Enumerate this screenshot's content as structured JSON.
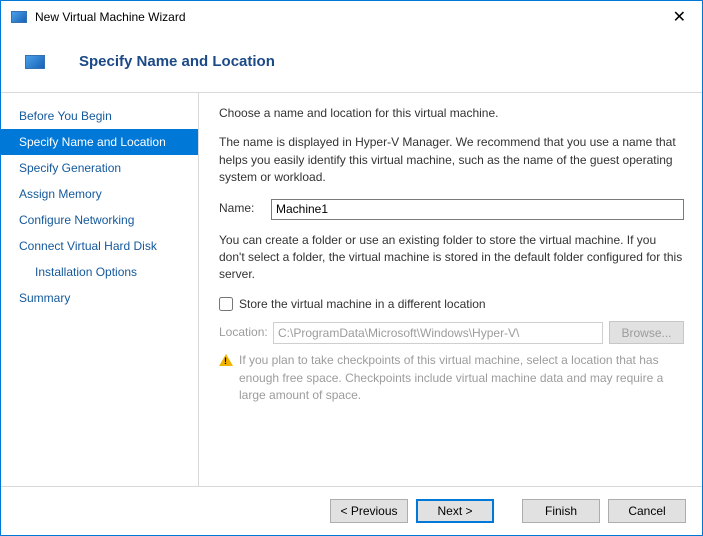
{
  "titlebar": {
    "title": "New Virtual Machine Wizard"
  },
  "header": {
    "title": "Specify Name and Location"
  },
  "sidebar": {
    "items": [
      {
        "label": "Before You Begin"
      },
      {
        "label": "Specify Name and Location"
      },
      {
        "label": "Specify Generation"
      },
      {
        "label": "Assign Memory"
      },
      {
        "label": "Configure Networking"
      },
      {
        "label": "Connect Virtual Hard Disk"
      },
      {
        "label": "Installation Options"
      },
      {
        "label": "Summary"
      }
    ]
  },
  "content": {
    "intro": "Choose a name and location for this virtual machine.",
    "name_help": "The name is displayed in Hyper-V Manager. We recommend that you use a name that helps you easily identify this virtual machine, such as the name of the guest operating system or workload.",
    "name_label": "Name:",
    "name_value": "Machine1",
    "folder_help": "You can create a folder or use an existing folder to store the virtual machine. If you don't select a folder, the virtual machine is stored in the default folder configured for this server.",
    "store_checkbox": "Store the virtual machine in a different location",
    "location_label": "Location:",
    "location_value": "C:\\ProgramData\\Microsoft\\Windows\\Hyper-V\\",
    "browse_label": "Browse...",
    "warning": "If you plan to take checkpoints of this virtual machine, select a location that has enough free space. Checkpoints include virtual machine data and may require a large amount of space."
  },
  "footer": {
    "previous": "< Previous",
    "next": "Next >",
    "finish": "Finish",
    "cancel": "Cancel"
  }
}
